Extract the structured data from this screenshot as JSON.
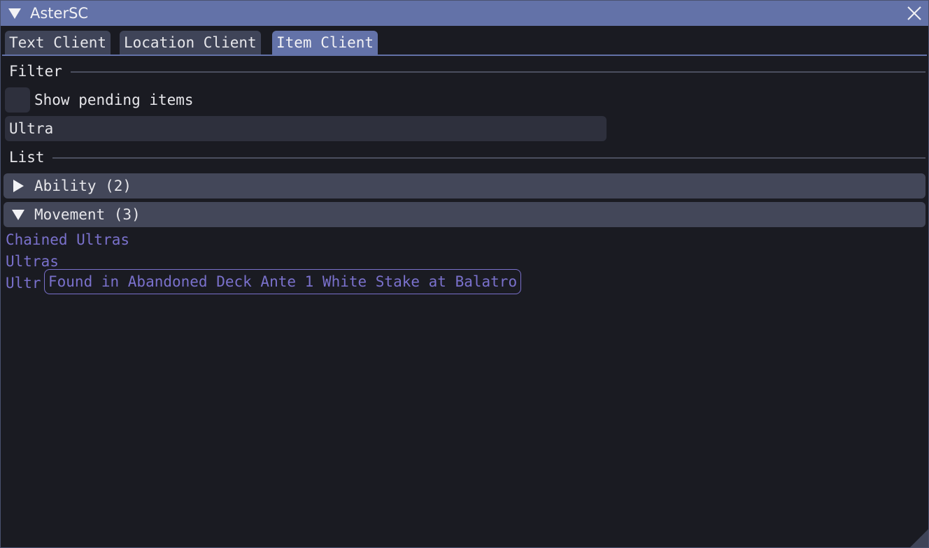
{
  "window": {
    "title": "AsterSC",
    "close_icon": "close-icon",
    "collapse_icon": "triangle-down-icon"
  },
  "tabs": [
    {
      "label": "Text Client",
      "active": false
    },
    {
      "label": "Location Client",
      "active": false
    },
    {
      "label": "Item Client",
      "active": true
    }
  ],
  "filter": {
    "section_label": "Filter",
    "show_pending": {
      "label": "Show pending items",
      "checked": false
    },
    "search_value": "Ultra"
  },
  "list": {
    "section_label": "List",
    "groups": [
      {
        "label": "Ability (2)",
        "expanded": false
      },
      {
        "label": "Movement (3)",
        "expanded": true,
        "items": [
          "Chained Ultras",
          "Ultras",
          "Ultr"
        ]
      }
    ]
  },
  "tooltip": {
    "text": "Found in Abandoned Deck Ante 1 White Stake at Balatro"
  },
  "colors": {
    "accent": "#6372a8",
    "background": "#1a1b22",
    "item_text": "#7a71cc",
    "frame": "#2e303d",
    "header": "#434759"
  }
}
